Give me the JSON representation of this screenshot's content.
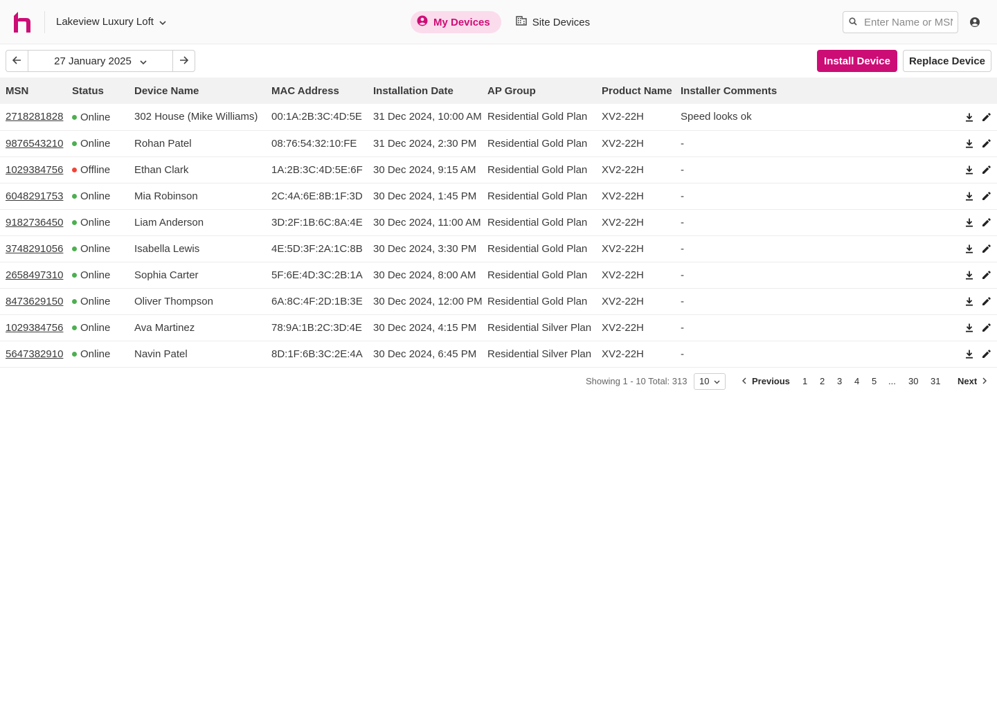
{
  "header": {
    "site_name": "Lakeview Luxury Loft",
    "tabs": [
      {
        "label": "My Devices",
        "active": true
      },
      {
        "label": "Site Devices",
        "active": false
      }
    ],
    "search_placeholder": "Enter Name or MSN"
  },
  "toolbar": {
    "date": "27 January 2025",
    "install_label": "Install Device",
    "replace_label": "Replace Device"
  },
  "table": {
    "columns": [
      "MSN",
      "Status",
      "Device Name",
      "MAC Address",
      "Installation Date",
      "AP Group",
      "Product Name",
      "Installer Comments"
    ],
    "rows": [
      {
        "msn": "2718281828",
        "status": "Online",
        "name": "302 House (Mike Williams)",
        "mac": "00:1A:2B:3C:4D:5E",
        "date": "31 Dec 2024, 10:00 AM",
        "group": "Residential Gold Plan",
        "product": "XV2-22H",
        "comment": "Speed looks ok"
      },
      {
        "msn": "9876543210",
        "status": "Online",
        "name": "Rohan Patel",
        "mac": "08:76:54:32:10:FE",
        "date": "31 Dec 2024, 2:30 PM",
        "group": "Residential Gold Plan",
        "product": "XV2-22H",
        "comment": "-"
      },
      {
        "msn": "1029384756",
        "status": "Offline",
        "name": "Ethan Clark",
        "mac": "1A:2B:3C:4D:5E:6F",
        "date": "30 Dec 2024, 9:15 AM",
        "group": "Residential Gold Plan",
        "product": "XV2-22H",
        "comment": "-"
      },
      {
        "msn": "6048291753",
        "status": "Online",
        "name": "Mia Robinson",
        "mac": "2C:4A:6E:8B:1F:3D",
        "date": "30 Dec 2024, 1:45 PM",
        "group": "Residential Gold Plan",
        "product": "XV2-22H",
        "comment": "-"
      },
      {
        "msn": "9182736450",
        "status": "Online",
        "name": "Liam Anderson",
        "mac": "3D:2F:1B:6C:8A:4E",
        "date": "30 Dec 2024, 11:00 AM",
        "group": "Residential Gold Plan",
        "product": "XV2-22H",
        "comment": "-"
      },
      {
        "msn": "3748291056",
        "status": "Online",
        "name": "Isabella Lewis",
        "mac": "4E:5D:3F:2A:1C:8B",
        "date": "30 Dec 2024, 3:30 PM",
        "group": "Residential Gold Plan",
        "product": "XV2-22H",
        "comment": "-"
      },
      {
        "msn": "2658497310",
        "status": "Online",
        "name": "Sophia Carter",
        "mac": "5F:6E:4D:3C:2B:1A",
        "date": "30 Dec 2024, 8:00 AM",
        "group": "Residential Gold Plan",
        "product": "XV2-22H",
        "comment": "-"
      },
      {
        "msn": "8473629150",
        "status": "Online",
        "name": "Oliver Thompson",
        "mac": "6A:8C:4F:2D:1B:3E",
        "date": "30 Dec 2024, 12:00 PM",
        "group": "Residential Gold Plan",
        "product": "XV2-22H",
        "comment": "-"
      },
      {
        "msn": "1029384756",
        "status": "Online",
        "name": "Ava Martinez",
        "mac": "78:9A:1B:2C:3D:4E",
        "date": "30 Dec 2024, 4:15 PM",
        "group": "Residential Silver Plan",
        "product": "XV2-22H",
        "comment": "-"
      },
      {
        "msn": "5647382910",
        "status": "Online",
        "name": "Navin Patel",
        "mac": "8D:1F:6B:3C:2E:4A",
        "date": "30 Dec 2024, 6:45 PM",
        "group": "Residential Silver Plan",
        "product": "XV2-22H",
        "comment": "-"
      }
    ]
  },
  "pagination": {
    "showing": "Showing 1 - 10 Total: 313",
    "page_size": "10",
    "previous": "Previous",
    "next": "Next",
    "pages": [
      "1",
      "2",
      "3",
      "4",
      "5",
      "...",
      "30",
      "31"
    ]
  },
  "colors": {
    "accent": "#cc0d75",
    "accent_light": "#fbdcec",
    "online": "#4caf50",
    "offline": "#f44336"
  },
  "icons": {
    "logo": "brand-logo-icon",
    "site_chevron": "chevron-down-icon",
    "my_devices": "user-circle-icon",
    "site_devices": "building-icon",
    "search": "search-icon",
    "account": "account-circle-icon",
    "date_prev": "arrow-left-icon",
    "date_next": "arrow-right-icon",
    "row_download": "download-icon",
    "row_edit": "pencil-icon"
  }
}
